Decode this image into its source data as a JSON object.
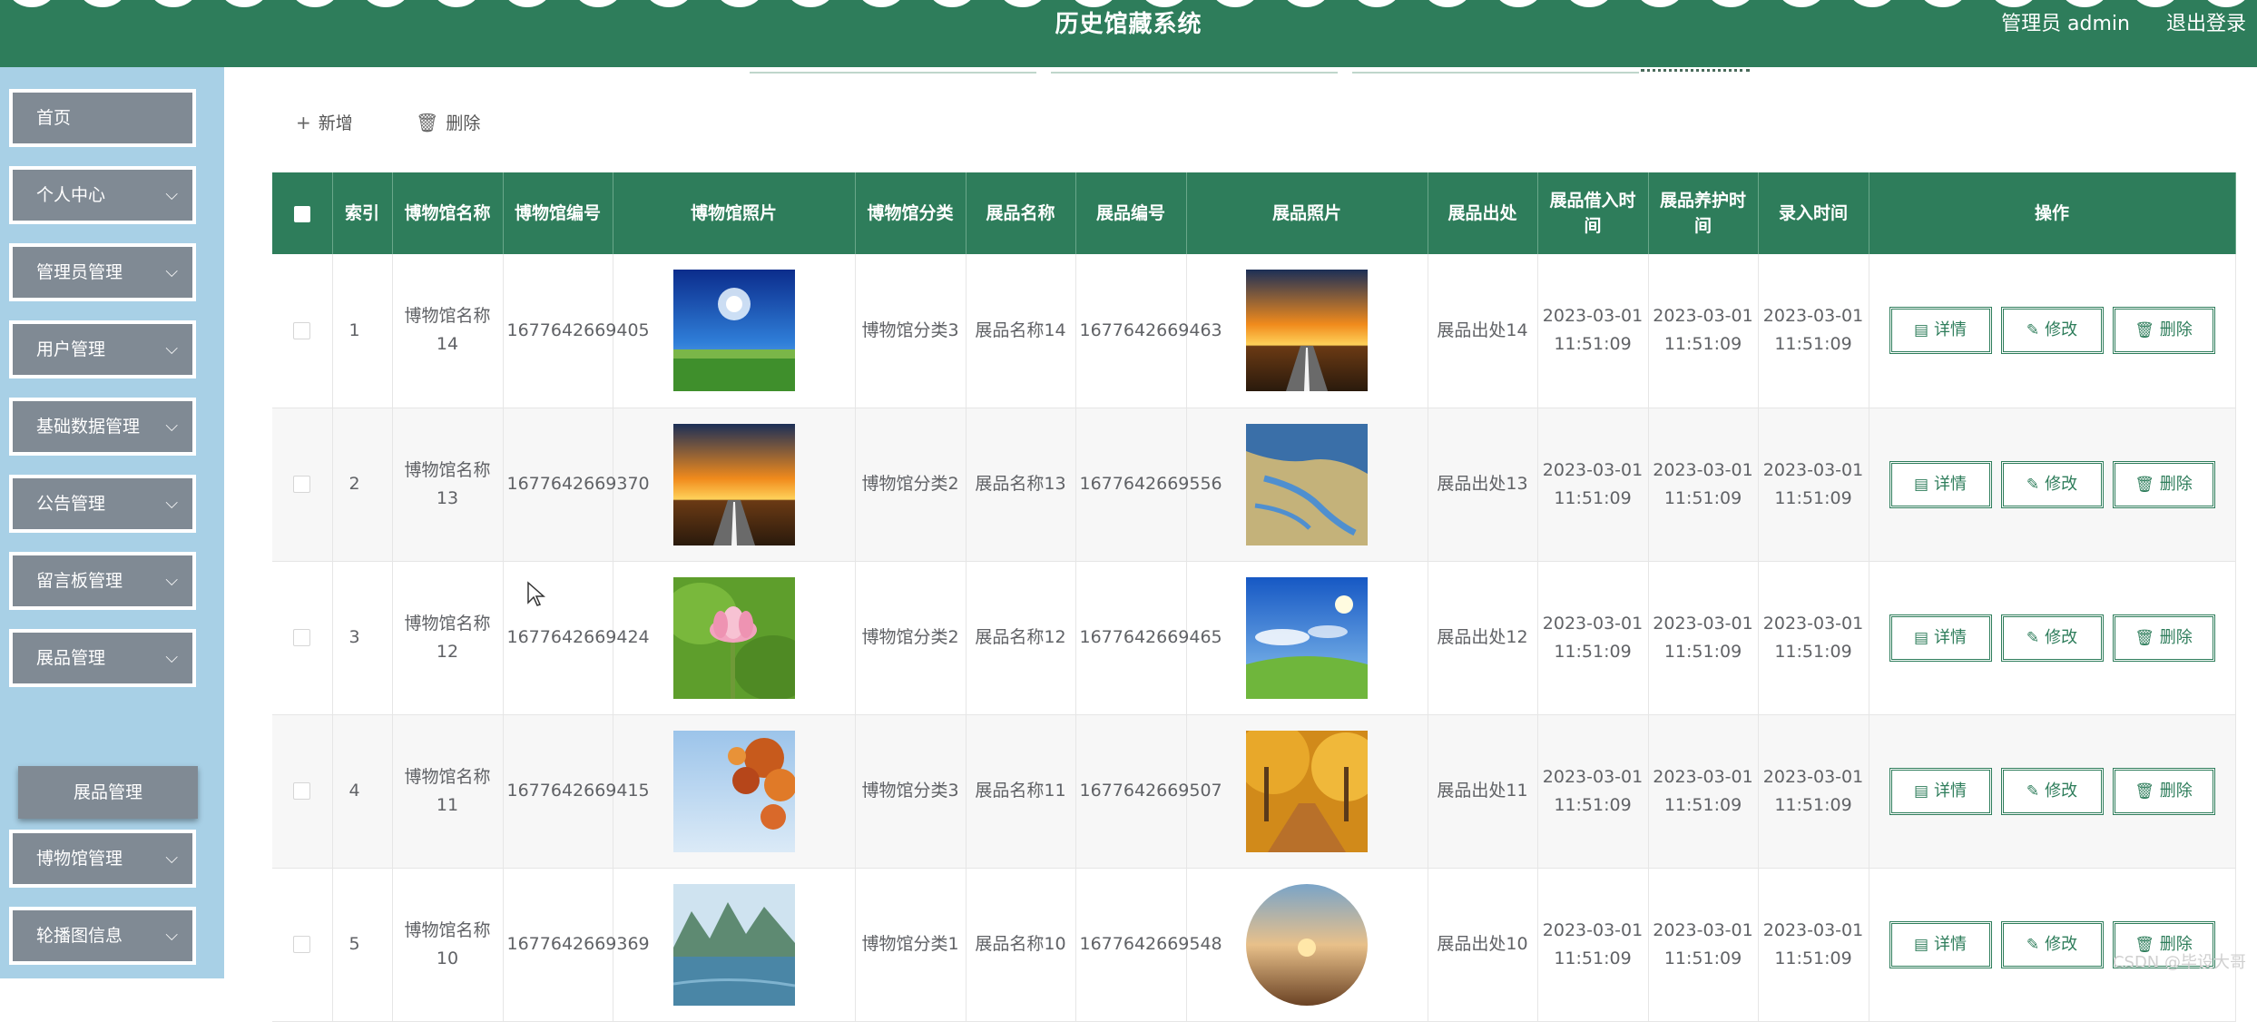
{
  "header": {
    "title": "历史馆藏系统",
    "admin_text": "管理员 admin",
    "logout": "退出登录"
  },
  "sidebar": {
    "items": [
      {
        "label": "首页",
        "chevron": false
      },
      {
        "label": "个人中心",
        "chevron": true
      },
      {
        "label": "管理员管理",
        "chevron": true
      },
      {
        "label": "用户管理",
        "chevron": true
      },
      {
        "label": "基础数据管理",
        "chevron": true
      },
      {
        "label": "公告管理",
        "chevron": true
      },
      {
        "label": "留言板管理",
        "chevron": true
      },
      {
        "label": "展品管理",
        "chevron": true
      },
      {
        "label": "博物馆管理",
        "chevron": true
      },
      {
        "label": "轮播图信息",
        "chevron": true
      }
    ],
    "submenu_label": "展品管理"
  },
  "toolbar": {
    "add_label": "新增",
    "delete_label": "删除"
  },
  "table": {
    "columns": [
      "索引",
      "博物馆名称",
      "博物馆编号",
      "博物馆照片",
      "博物馆分类",
      "展品名称",
      "展品编号",
      "展品照片",
      "展品出处",
      "展品借入时间",
      "展品养护时间",
      "录入时间",
      "操作"
    ],
    "actions": {
      "detail": "详情",
      "edit": "修改",
      "delete": "删除"
    },
    "rows": [
      {
        "index": "1",
        "museum_name": "博物馆名称14",
        "museum_no": "1677642669405",
        "museum_photo": "sky-field",
        "category": "博物馆分类3",
        "exhibit_name": "展品名称14",
        "exhibit_no": "1677642669463",
        "exhibit_photo": "sunset-road",
        "source": "展品出处14",
        "borrow_time": "2023-03-01 11:51:09",
        "care_time": "2023-03-01 11:51:09",
        "entry_time": "2023-03-01 11:51:09"
      },
      {
        "index": "2",
        "museum_name": "博物馆名称13",
        "museum_no": "1677642669370",
        "museum_photo": "sunset-road",
        "category": "博物馆分类2",
        "exhibit_name": "展品名称13",
        "exhibit_no": "1677642669556",
        "exhibit_photo": "river-delta",
        "source": "展品出处13",
        "borrow_time": "2023-03-01 11:51:09",
        "care_time": "2023-03-01 11:51:09",
        "entry_time": "2023-03-01 11:51:09"
      },
      {
        "index": "3",
        "museum_name": "博物馆名称12",
        "museum_no": "1677642669424",
        "museum_photo": "lotus",
        "category": "博物馆分类2",
        "exhibit_name": "展品名称12",
        "exhibit_no": "1677642669465",
        "exhibit_photo": "green-hill",
        "source": "展品出处12",
        "borrow_time": "2023-03-01 11:51:09",
        "care_time": "2023-03-01 11:51:09",
        "entry_time": "2023-03-01 11:51:09"
      },
      {
        "index": "4",
        "museum_name": "博物馆名称11",
        "museum_no": "1677642669415",
        "museum_photo": "autumn-leaves",
        "category": "博物馆分类3",
        "exhibit_name": "展品名称11",
        "exhibit_no": "1677642669507",
        "exhibit_photo": "autumn-path",
        "source": "展品出处11",
        "borrow_time": "2023-03-01 11:51:09",
        "care_time": "2023-03-01 11:51:09",
        "entry_time": "2023-03-01 11:51:09"
      },
      {
        "index": "5",
        "museum_name": "博物馆名称10",
        "museum_no": "1677642669369",
        "museum_photo": "karst-lake",
        "category": "博物馆分类1",
        "exhibit_name": "展品名称10",
        "exhibit_no": "1677642669548",
        "exhibit_photo": "fisheye-sunset",
        "source": "展品出处10",
        "borrow_time": "2023-03-01 11:51:09",
        "care_time": "2023-03-01 11:51:09",
        "entry_time": "2023-03-01 11:51:09"
      }
    ]
  },
  "watermark": "CSDN @毕设大哥",
  "colors": {
    "primary": "#2e7d5b",
    "sidebar_bg": "#a8d0e6",
    "menu_item_bg": "#808a94"
  }
}
